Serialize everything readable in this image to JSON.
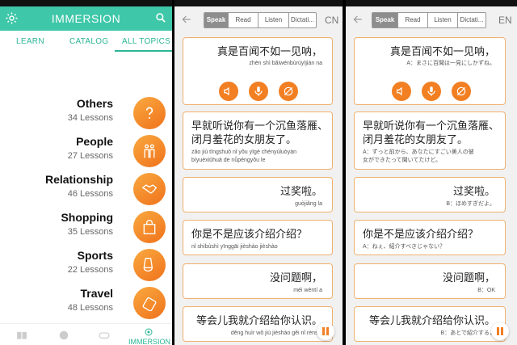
{
  "panel1": {
    "header_title": "IMMERSION",
    "tabs": [
      "LEARN",
      "CATALOG",
      "ALL TOPICS"
    ],
    "topics": [
      {
        "name": "Others",
        "lessons": "34 Lessons"
      },
      {
        "name": "People",
        "lessons": "27 Lessons"
      },
      {
        "name": "Relationship",
        "lessons": "46 Lessons"
      },
      {
        "name": "Shopping",
        "lessons": "35 Lessons"
      },
      {
        "name": "Sports",
        "lessons": "22 Lessons"
      },
      {
        "name": "Travel",
        "lessons": "48 Lessons"
      }
    ],
    "bottom_nav_active": "IMMERSION"
  },
  "panel2": {
    "modes": [
      "Speak",
      "Read",
      "Listen",
      "Dictati..."
    ],
    "lang": "CN",
    "cards": [
      {
        "zh": "真是百闻不如一见呐，",
        "sub": "zhēn shì bǎiwénbùrúyījiàn na"
      },
      {
        "zh1": "早就听说你有一个沉鱼落雁、",
        "zh2": "闭月羞花的女朋友了。",
        "sub1": "zǎo jiù tīngshuō nǐ yǒu yīgè chényúluòyàn",
        "sub2": "bìyuèxiūhuā de nǚpéngyǒu le"
      },
      {
        "zh": "过奖啦。",
        "sub": "guòjiǎng la"
      },
      {
        "zh": "你是不是应该介绍介绍？",
        "sub": "nǐ shìbùshì yīnggāi jièshào jièshào"
      },
      {
        "zh": "没问题啊，",
        "sub": "méi wèntí a"
      },
      {
        "zh": "等会儿我就介绍给你认识。",
        "sub": "děng huìr wǒ jiù jièshào gěi nǐ rènshi"
      }
    ]
  },
  "panel3": {
    "modes": [
      "Speak",
      "Read",
      "Listen",
      "Dictati..."
    ],
    "lang": "EN",
    "cards": [
      {
        "zh": "真是百闻不如一见呐，",
        "sub": "A：まさに百聞は一見にしかずね。"
      },
      {
        "zh1": "早就听说你有一个沉鱼落雁、",
        "zh2": "闭月羞花的女朋友了。",
        "sub1": "A：ずっと前から、あなたにすごい美人の彼",
        "sub2": "女ができたって聞いてたけど。"
      },
      {
        "zh": "过奖啦。",
        "sub": "B：ほめすぎだよ。"
      },
      {
        "zh": "你是不是应该介绍介绍？",
        "sub": "A：ねぇ、紹介すべきじゃない？"
      },
      {
        "zh": "没问题啊，",
        "sub": "B：OK"
      },
      {
        "zh": "等会儿我就介绍给你认识。",
        "sub": "B：あとで紹介するよ"
      }
    ]
  },
  "colors": {
    "teal": "#3ec7a8",
    "orange": "#f27f22",
    "card_border": "#f0b16f"
  }
}
